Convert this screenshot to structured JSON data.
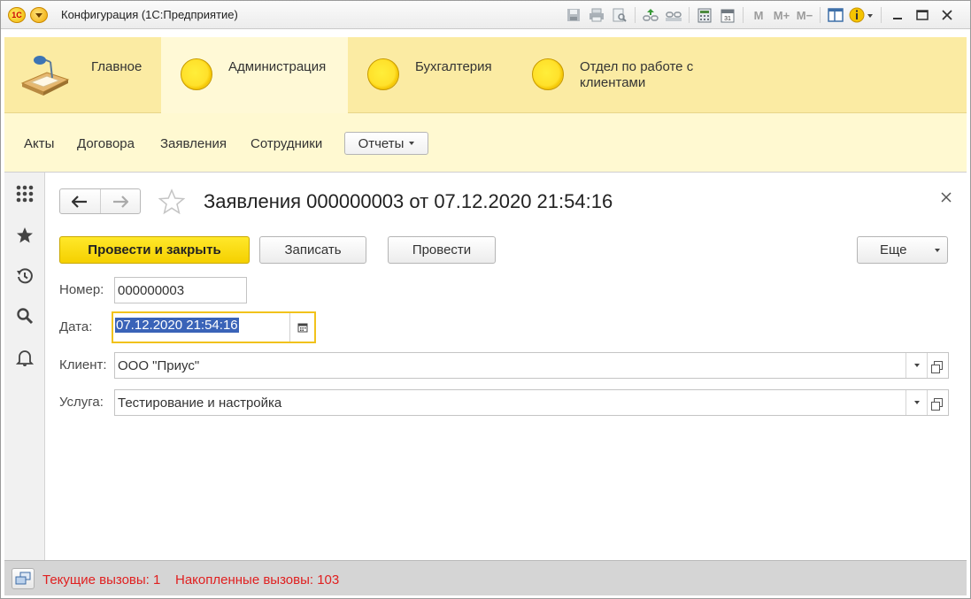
{
  "window": {
    "title": "Конфигурация (1С:Предприятие)",
    "logo_text": "1С"
  },
  "toolbar_icons": [
    "save-icon",
    "print-icon",
    "preview-icon",
    "link-up-icon",
    "link-down-icon",
    "calculator-icon",
    "calendar-icon",
    "memory-m-icon",
    "memory-plus-icon",
    "memory-minus-icon",
    "panel-icon",
    "info-icon",
    "minimize-icon",
    "maximize-icon",
    "close-icon"
  ],
  "memory_buttons": {
    "m": "M",
    "m_plus": "M+",
    "m_minus": "M−"
  },
  "calendar_day": "31",
  "sections": [
    {
      "label": "Главное",
      "icon": "desk-lamp-icon"
    },
    {
      "label": "Администрация",
      "icon": "yellow-circle-icon",
      "active": true
    },
    {
      "label": "Бухгалтерия",
      "icon": "yellow-circle-icon"
    },
    {
      "label": "Отдел по работе с клиентами",
      "icon": "yellow-circle-icon"
    }
  ],
  "functions": {
    "items": [
      "Акты",
      "Договора",
      "Заявления",
      "Сотрудники"
    ],
    "reports_label": "Отчеты"
  },
  "form": {
    "title": "Заявления 000000003 от 07.12.2020 21:54:16",
    "buttons": {
      "post_close": "Провести и закрыть",
      "write": "Записать",
      "post": "Провести",
      "more": "Еще"
    },
    "fields": {
      "number_label": "Номер:",
      "number_value": "000000003",
      "date_label": "Дата:",
      "date_value": "07.12.2020 21:54:16",
      "client_label": "Клиент:",
      "client_value": "ООО \"Приус\"",
      "service_label": "Услуга:",
      "service_value": "Тестирование и настройка"
    }
  },
  "status": {
    "current_calls": "Текущие вызовы: 1",
    "accumulated_calls": "Накопленные вызовы: 103"
  },
  "colors": {
    "sections_bg": "#fbeba3",
    "functions_bg": "#fff9d1",
    "primary_button": "#f5d000",
    "status_text": "#e02020",
    "selection": "#3a63b8"
  }
}
